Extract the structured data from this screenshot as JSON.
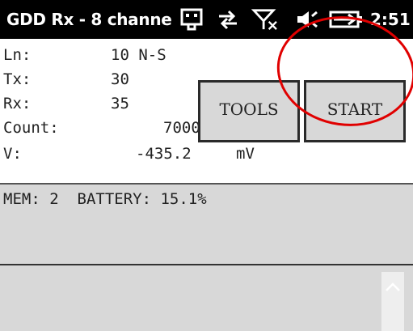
{
  "titlebar": {
    "title": "GDD Rx - 8 channe",
    "clock": "2:51",
    "icons": [
      "keyboard-icon",
      "sync-arrows-icon",
      "no-signal-icon",
      "speaker-icon",
      "battery-charging-icon"
    ]
  },
  "readings": {
    "line_label": "Ln:",
    "line_value": "10 N-S",
    "tx_label": "Tx:",
    "tx_value": "30",
    "rx_label": "Rx:",
    "rx_value": "35",
    "count_label": "Count:",
    "count_value": "7000",
    "voltage_label": "V:",
    "voltage_value": "-435.2",
    "voltage_unit": "mV"
  },
  "buttons": {
    "tools_label": "TOOLS",
    "start_label": "START"
  },
  "status": {
    "text": "MEM: 2  BATTERY: 15.1%"
  },
  "colors": {
    "titlebar_bg": "#000000",
    "panel_bg": "#d8d8d8",
    "annotation": "#e00000"
  }
}
